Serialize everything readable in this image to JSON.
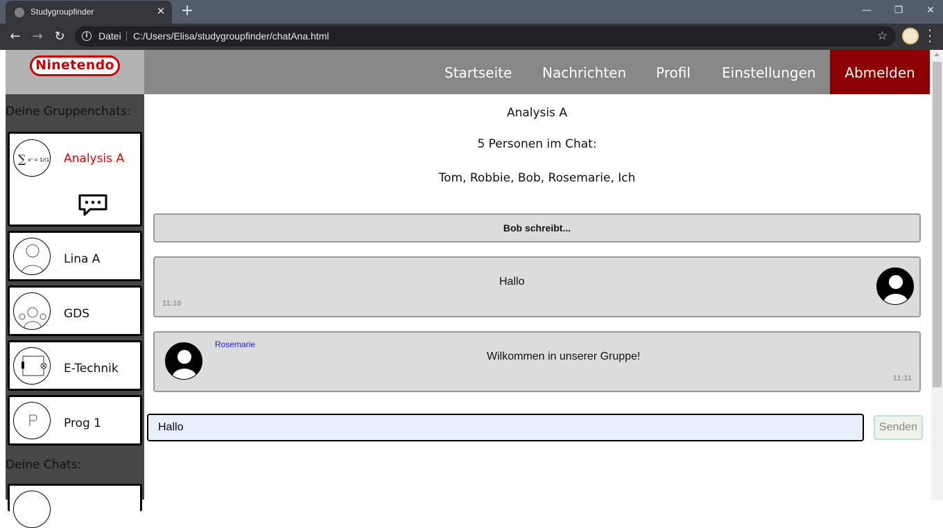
{
  "browser": {
    "tab_title": "Studygroupfinder",
    "protocol_label": "Datei",
    "url": "C:/Users/Elisa/studygroupfinder/chatAna.html"
  },
  "logo": {
    "text": "Ninetendo"
  },
  "nav": {
    "home": "Startseite",
    "messages": "Nachrichten",
    "profile": "Profil",
    "settings": "Einstellungen",
    "logout": "Abmelden"
  },
  "sidebar": {
    "group_chats_heading": "Deine Gruppenchats:",
    "groups": [
      {
        "label": "Analysis A",
        "active": true
      },
      {
        "label": "Lina A"
      },
      {
        "label": "GDS"
      },
      {
        "label": "E-Technik"
      },
      {
        "label": "Prog 1"
      }
    ],
    "chats_heading": "Deine Chats:"
  },
  "chat": {
    "title": "Analysis A",
    "member_count": "5 Personen im Chat:",
    "members": "Tom, Robbie, Bob, Rosemarie, Ich",
    "typing": "Bob schreibt...",
    "messages": [
      {
        "text": "Hallo",
        "time": "11:10",
        "own": true
      },
      {
        "sender": "Rosemarie",
        "text": "Wilkommen in unserer Gruppe!",
        "time": "11:11",
        "own": false
      }
    ]
  },
  "composer": {
    "value": "Hallo",
    "send_label": "Senden"
  },
  "colors": {
    "logout_bg": "#8b0000",
    "nav_bg": "#878787",
    "sidebar_bg": "#474747",
    "active_group": "#e00000",
    "sender_name": "#1a1aff"
  }
}
